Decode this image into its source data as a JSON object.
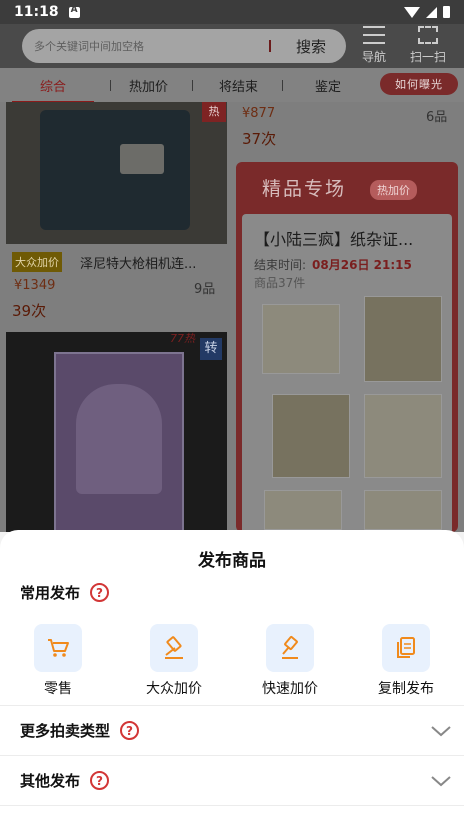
{
  "status_bar": {
    "time": "11:18"
  },
  "header": {
    "search_placeholder": "多个关键词中间加空格",
    "search_button": "搜索",
    "nav_label": "导航",
    "scan_label": "扫一扫"
  },
  "tabs": {
    "items": [
      "综合",
      "热加价",
      "将结束",
      "鉴定"
    ],
    "active_index": 0,
    "how_button": "如何曝光"
  },
  "feed": {
    "left_top": {
      "badge": "热",
      "tag": "大众加价",
      "title": "泽尼特大枪相机连...",
      "price": "¥1349",
      "pieces": "9品",
      "bids": "39次"
    },
    "left_bottom": {
      "hot_label": "77热",
      "badge": "转"
    },
    "right_top": {
      "price": "¥877",
      "pieces": "6品",
      "bids": "37次"
    },
    "boutique": {
      "title": "精品专场",
      "badge": "热加价",
      "lot_title": "【小陆三疯】纸杂证...",
      "end_label": "结束时间:",
      "end_time": "08月26日 21:15",
      "lot_count": "商品37件"
    }
  },
  "sheet": {
    "title": "发布商品",
    "common_section": "常用发布",
    "actions": [
      {
        "label": "零售",
        "icon": "cart-icon"
      },
      {
        "label": "大众加价",
        "icon": "gavel-icon"
      },
      {
        "label": "快速加价",
        "icon": "quick-gavel-icon"
      },
      {
        "label": "复制发布",
        "icon": "copy-icon"
      }
    ],
    "more_section": "更多拍卖类型",
    "other_section": "其他发布"
  },
  "colors": {
    "accent_red": "#d23636",
    "icon_orange": "#f08a1c",
    "icon_bg": "#e8f1fd",
    "overlay": "rgba(0,0,0,0.5)"
  }
}
